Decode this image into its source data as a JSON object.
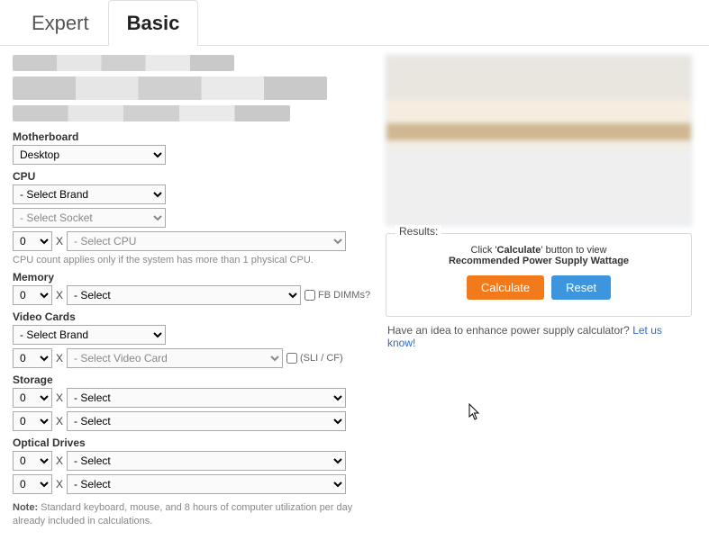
{
  "tabs": {
    "expert": "Expert",
    "basic": "Basic"
  },
  "motherboard": {
    "label": "Motherboard",
    "value": "Desktop"
  },
  "cpu": {
    "label": "CPU",
    "brand": "- Select Brand",
    "socket": "- Select Socket",
    "count": "0",
    "model": "- Select CPU",
    "hint": "CPU count applies only if the system has more than 1 physical CPU."
  },
  "memory": {
    "label": "Memory",
    "count": "0",
    "value": "- Select",
    "fbdimms": "FB DIMMs?"
  },
  "video": {
    "label": "Video Cards",
    "brand": "- Select Brand",
    "count": "0",
    "model": "- Select Video Card",
    "slicf": "(SLI / CF)"
  },
  "storage": {
    "label": "Storage",
    "rows": [
      {
        "count": "0",
        "value": "- Select"
      },
      {
        "count": "0",
        "value": "- Select"
      }
    ]
  },
  "optical": {
    "label": "Optical Drives",
    "rows": [
      {
        "count": "0",
        "value": "- Select"
      },
      {
        "count": "0",
        "value": "- Select"
      }
    ]
  },
  "note": {
    "prefix": "Note:",
    "text": " Standard keyboard, mouse, and 8 hours of computer utilization per day already included in calculations."
  },
  "results": {
    "legend": "Results:",
    "line1_pre": "Click '",
    "line1_bold": "Calculate",
    "line1_post": "' button to view",
    "line2": "Recommended Power Supply Wattage",
    "calc": "Calculate",
    "reset": "Reset"
  },
  "feedback": {
    "text": "Have an idea to enhance power supply calculator? ",
    "link": "Let us know!"
  },
  "x": "X"
}
